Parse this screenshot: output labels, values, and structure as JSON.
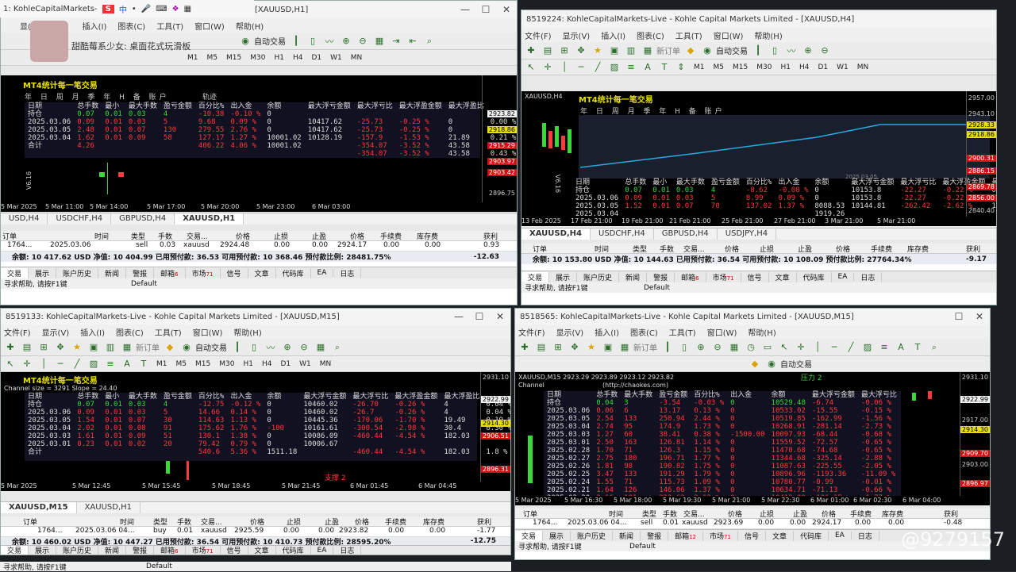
{
  "topbar": {
    "title_fragment": "1: KohleCapitalMarkets-",
    "symbol": "[XAUUSD,H1]",
    "sogou": "S",
    "cn": "中"
  },
  "overlay": {
    "widget_text": "甜酷莓系少女: 桌面花式玩滑板"
  },
  "watermark": "@9279157",
  "menus": {
    "tl": [
      "显(V)",
      "插入(I)",
      "图表(C)",
      "工具(T)",
      "窗口(W)",
      "帮助(H)"
    ],
    "tr": [
      "文件(F)",
      "显示(V)",
      "插入(I)",
      "图表(C)",
      "工具(T)",
      "窗口(W)",
      "帮助(H)"
    ],
    "bl": [
      "文件(F)",
      "显示(V)",
      "插入(I)",
      "图表(C)",
      "工具(T)",
      "窗口(W)",
      "帮助(H)"
    ],
    "br": [
      "文件(F)",
      "显示(V)",
      "插入(I)",
      "图表(C)",
      "工具(T)",
      "窗口(W)",
      "帮助(H)"
    ]
  },
  "toolbar": {
    "auto_trade": "自动交易",
    "new_order": "新订单",
    "timeframes": [
      "M1",
      "M5",
      "M15",
      "M30",
      "H1",
      "H4",
      "D1",
      "W1",
      "MN"
    ]
  },
  "windows": {
    "tr": {
      "title": "8519224: KohleCapitalMarkets-Live - Kohle Capital Markets Limited - [XAUUSD,H4]"
    },
    "bl": {
      "title": "8519133: KohleCapitalMarkets-Live - Kohle Capital Markets Limited - [XAUUSD,M15]"
    },
    "br": {
      "title": "8518565: KohleCapitalMarkets-Live - Kohle Capital Markets Limited - [XAUUSD,M15]"
    }
  },
  "panel": {
    "title": "MT4统计每一笔交易",
    "subtabs": "年 日 周 月 季 年 H 备 账户",
    "track": "轨迹",
    "headers": [
      "日期",
      "总手数",
      "最小",
      "最大手数",
      "盈亏金额",
      "百分比%",
      "出入金",
      "余额",
      "最大浮亏金额",
      "最大浮亏比",
      "最大浮盈金额",
      "最大浮盈比"
    ]
  },
  "tl_stats": {
    "rows": [
      [
        "持仓",
        "0.07",
        "0.01",
        "0.03",
        "4",
        "-10.38",
        "-0.10 %",
        "0",
        "",
        "",
        "",
        "",
        ""
      ],
      [
        "2025.03.06",
        "0.09",
        "0.01",
        "0.03",
        "5",
        "9.68",
        "0.09 %",
        "0",
        "10417.62",
        "-25.73",
        "-0.25 %",
        "0",
        "0.00 %"
      ],
      [
        "2025.03.05",
        "2.48",
        "0.01",
        "0.07",
        "130",
        "279.55",
        "2.76 %",
        "0",
        "10417.62",
        "-25.73",
        "-0.25 %",
        "0",
        "0.00 %"
      ],
      [
        "2025.03.04",
        "1.62",
        "0.01",
        "0.09",
        "58",
        "127.17",
        "1.27 %",
        "10001.02",
        "10128.19",
        "-157.9",
        "-1.53 %",
        "21.89",
        "0.21 %"
      ],
      [
        "合计",
        "4.26",
        "",
        "",
        "",
        "406.22",
        "4.06 %",
        "10001.02",
        "",
        "-354.07",
        "-3.52 %",
        "43.58",
        "0.43 %"
      ],
      [
        "",
        "",
        "",
        "",
        "",
        "",
        "",
        "",
        "",
        "-354.07",
        "-3.52 %",
        "43.58",
        "0.43 %"
      ]
    ],
    "prices": [
      "2923.82",
      "2918.86",
      "2915.29",
      "2903.97",
      "2903.42",
      "2896.75"
    ],
    "times": [
      "5 Mar 2025",
      "5 Mar 11:00",
      "5 Mar 14:00",
      "5 Mar 17:00",
      "5 Mar 20:00",
      "5 Mar 23:00",
      "6 Mar 03:00"
    ],
    "indicator": "V6.16"
  },
  "tr_stats": {
    "label": "XAUUSD,H4",
    "chart_date": "2025.03.05",
    "rows": [
      [
        "持仓",
        "0.07",
        "0.01",
        "0.03",
        "4",
        "-8.62",
        "-0.08 %",
        "0",
        "10153.8",
        "-22.27",
        "-0.22 %",
        "0",
        "0 %"
      ],
      [
        "2025.03.06",
        "0.09",
        "0.01",
        "0.03",
        "5",
        "8.99",
        "0.09 %",
        "0",
        "10153.8",
        "-22.27",
        "-0.22 %",
        "0",
        "0 %"
      ],
      [
        "2025.03.05",
        "1.52",
        "0.01",
        "0.07",
        "70",
        "137.02",
        "1.37 %",
        "8088.53",
        "10144.81",
        "-262.42",
        "-2.62 %",
        "10.41",
        "0.1 %"
      ],
      [
        "2025.03.04",
        "",
        "",
        "",
        "",
        "",
        "",
        "1919.26",
        "",
        "",
        "",
        "",
        ""
      ]
    ],
    "prices": [
      "2957.00",
      "2943.10",
      "2928.33",
      "2918.86",
      "2900.31",
      "2886.15",
      "2869.78",
      "2856.00",
      "2840.40"
    ],
    "times": [
      "13 Feb 2025",
      "17 Feb 21:00",
      "19 Feb 21:00",
      "21 Feb 21:00",
      "25 Feb 21:00",
      "27 Feb 21:00",
      "3 Mar 21:00",
      "5 Mar 21:00"
    ],
    "indicator": "V6.16"
  },
  "bl_stats": {
    "channel": "Channel size = 3291  Slope = 24.40",
    "rows": [
      [
        "持仓",
        "0.07",
        "0.01",
        "0.03",
        "4",
        "-12.75",
        "-0.12 %",
        "0",
        "10460.02",
        "-26.70",
        "-0.26 %",
        "4",
        "0.04 %"
      ],
      [
        "2025.03.06",
        "0.09",
        "0.01",
        "0.03",
        "5",
        "14.66",
        "0.14 %",
        "0",
        "10460.02",
        "-26.7",
        "-0.26 %",
        "4",
        "0.04 %"
      ],
      [
        "2025.03.05",
        "1.54",
        "0.01",
        "0.07",
        "30",
        "114.63",
        "1.13 %",
        "0",
        "10445.36",
        "-170.06",
        "-1.70 %",
        "19.49",
        "0.19 %"
      ],
      [
        "2025.03.04",
        "2.02",
        "0.01",
        "0.08",
        "91",
        "175.62",
        "1.76 %",
        "-100",
        "10161.61",
        "-300.54",
        "-2.98 %",
        "30.4",
        "0.30 %"
      ],
      [
        "2025.03.03",
        "1.61",
        "0.01",
        "0.09",
        "51",
        "130.1",
        "1.38 %",
        "0",
        "10086.09",
        "-460.44",
        "-4.54 %",
        "182.03",
        "1.8 %"
      ],
      [
        "2025.03.01",
        "0.23",
        "0.01",
        "0.02",
        "20",
        "79.42",
        "0.79 %",
        "0",
        "10006.67",
        "",
        "",
        "",
        ""
      ],
      [
        "合计",
        "",
        "",
        "",
        "",
        "540.6",
        "5.36 %",
        "1511.18",
        "",
        "-460.44",
        "-4.54 %",
        "182.03",
        "1.8 %"
      ]
    ],
    "prices": [
      "2931.10",
      "2922.99",
      "2914.30",
      "2906.51",
      "2896.31"
    ],
    "times": [
      "5 Mar 2025",
      "5 Mar 12:45",
      "5 Mar 15:45",
      "5 Mar 18:45",
      "5 Mar 21:45",
      "6 Mar 01:45",
      "6 Mar 04:45"
    ],
    "support": "支撑 2"
  },
  "br_stats": {
    "header_line": "XAUUSD,M15  2923.29 2923.89 2923.12 2923.82",
    "channel": "Channel",
    "link": "(http://chaokes.com)",
    "resist": "压力 2",
    "rows": [
      [
        "持仓",
        "0.04",
        "3",
        "-3.54",
        "-0.03 %",
        "0",
        "10529.48",
        "-6.74",
        "-0.06 %"
      ],
      [
        "2025.03.06",
        "0.06",
        "6",
        "13.17",
        "0.13 %",
        "0",
        "10533.02",
        "-15.55",
        "-0.15 %"
      ],
      [
        "2025.03.05",
        "2.54",
        "133",
        "250.94",
        "2.44 %",
        "0",
        "10519.85",
        "-162.99",
        "-1.56 %"
      ],
      [
        "2025.03.04",
        "2.74",
        "95",
        "174.9",
        "1.73 %",
        "0",
        "10268.91",
        "-281.14",
        "-2.73 %"
      ],
      [
        "2025.03.03",
        "1.27",
        "60",
        "38.41",
        "0.38 %",
        "-1500.00",
        "10097.93",
        "-68.44",
        "-0.68 %"
      ],
      [
        "2025.03.01",
        "2.50",
        "163",
        "126.81",
        "1.14 %",
        "0",
        "11559.52",
        "-72.57",
        "-0.65 %"
      ],
      [
        "2025.02.28",
        "1.70",
        "71",
        "126.3",
        "1.15 %",
        "0",
        "11470.68",
        "-74.68",
        "-0.65 %"
      ],
      [
        "2025.02.27",
        "2.75",
        "180",
        "196.71",
        "1.77 %",
        "0",
        "11344.68",
        "-325.14",
        "-2.88 %"
      ],
      [
        "2025.02.26",
        "1.81",
        "98",
        "190.82",
        "1.75 %",
        "0",
        "11087.63",
        "-225.55",
        "-2.05 %"
      ],
      [
        "2025.02.25",
        "3.47",
        "133",
        "191.29",
        "1.79 %",
        "0",
        "10896.96",
        "-1193.36",
        "-11.09 %"
      ],
      [
        "2025.02.24",
        "1.55",
        "71",
        "115.73",
        "1.09 %",
        "0",
        "10780.77",
        "-0.99",
        "-0.01 %"
      ],
      [
        "2025.02.21",
        "1.64",
        "126",
        "146.06",
        "1.37 %",
        "0",
        "10634.71",
        "-71.13",
        "-0.66 %"
      ],
      [
        "2025.02.20",
        "2.16",
        "101",
        "222.62",
        "2.13 %",
        "0",
        "10412.09",
        "-181.15",
        "-1.77 %"
      ],
      [
        "2025.02.19",
        "1.34",
        "93",
        "182.36",
        "1.77 %",
        "0",
        "10249.96",
        "-200.22",
        "-1.95 %"
      ]
    ],
    "prices": [
      "2931.10",
      "2922.99",
      "2917.00",
      "2914.30",
      "2909.70",
      "2903.00",
      "2896.97"
    ],
    "times": [
      "5 Mar 2025",
      "5 Mar 16:30",
      "5 Mar 18:00",
      "5 Mar 19:30",
      "5 Mar 21:00",
      "5 Mar 22:30",
      "6 Mar 01:00",
      "6 Mar 02:30",
      "6 Mar 04:00"
    ]
  },
  "symtabs": {
    "tl": [
      "USD,H4",
      "USDCHF,H4",
      "GBPUSD,H4",
      "XAUUSD,H1"
    ],
    "tr": [
      "XAUUSD,H4",
      "USDCHF,H4",
      "GBPUSD,H4",
      "USDJPY,H4"
    ],
    "bl": [
      "XAUUSD,M15",
      "XAUUSD,H1"
    ]
  },
  "terminal_headers": [
    "订单",
    "时间",
    "类型",
    "手数",
    "交易...",
    "价格",
    "止损",
    "止盈",
    "价格",
    "手续费",
    "库存费",
    "获利"
  ],
  "terminals": {
    "tl": {
      "order": [
        "1764...",
        "2025.03.06",
        "sell",
        "0.03",
        "xauusd",
        "2924.48",
        "0.00",
        "0.00",
        "2924.17",
        "0.00",
        "0.00",
        "0.93"
      ],
      "balance": "余额: 10 417.62 USD  净值: 10 404.99  已用预付款: 36.53  可用预付款: 10 368.46  预付款比例: 28481.75%",
      "profit": "-12.63"
    },
    "tr": {
      "balance": "余额: 10 153.80 USD  净值: 10 144.63  已用预付款: 36.54  可用预付款: 10 108.09  预付款比例: 27764.34%",
      "profit": "-9.17"
    },
    "bl": {
      "order": [
        "1764...",
        "2025.03.06 04...",
        "buy",
        "0.01",
        "xauusd",
        "2925.59",
        "0.00",
        "0.00",
        "2923.82",
        "0.00",
        "0.00",
        "-1.77"
      ],
      "balance": "余额: 10 460.02 USD  净值: 10 447.27  已用预付款: 36.54  可用预付款: 10 410.73  预付款比例: 28595.20%",
      "profit": "-12.75"
    },
    "br": {
      "order": [
        "1764...",
        "2025.03.06 04...",
        "sell",
        "0.01",
        "xauusd",
        "2923.69",
        "0.00",
        "0.00",
        "2924.17",
        "0.00",
        "0.00",
        "-0.48"
      ]
    }
  },
  "bottom_tabs": [
    "交易",
    "展示",
    "账户历史",
    "新闻",
    "警报",
    "邮箱",
    "市场",
    "信号",
    "文章",
    "代码库",
    "EA",
    "日志"
  ],
  "badges": {
    "mail_tl": "6",
    "market_tl": "71",
    "mail_br": "12",
    "market_br": "71"
  },
  "status": {
    "help": "寻求帮助, 请按F1键",
    "profile": "Default"
  },
  "colors": {
    "up": "#38d838",
    "down": "#ff3a3a",
    "panel_title": "#e8e000",
    "chart_bg": "#000000"
  }
}
